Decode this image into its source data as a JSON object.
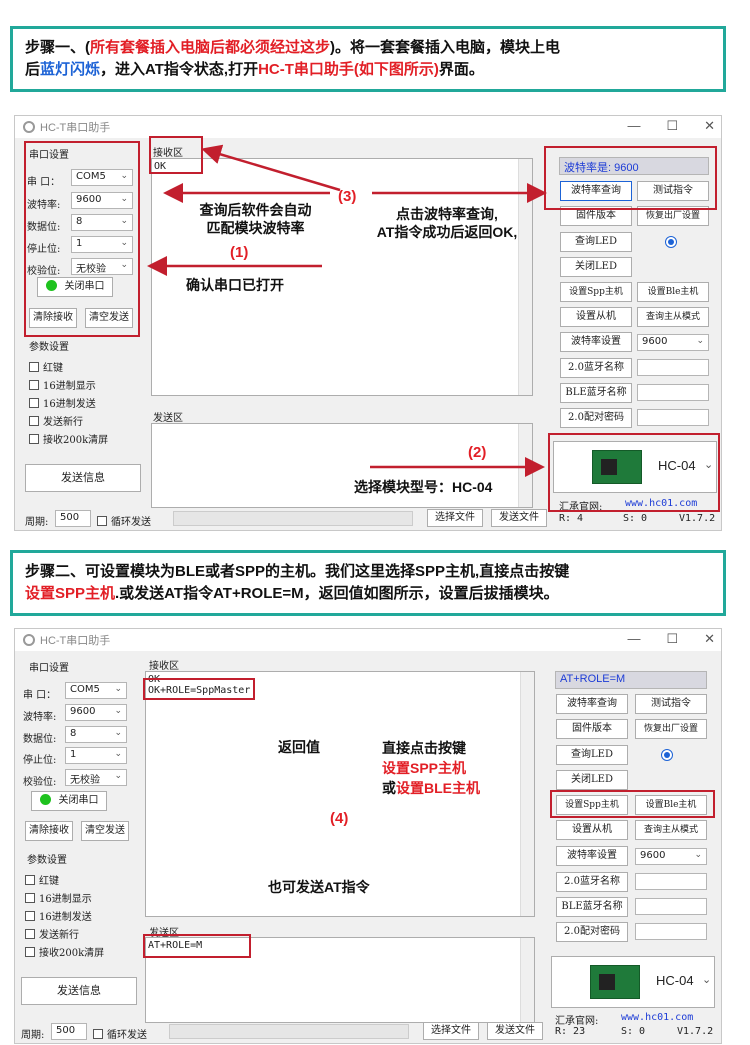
{
  "step1": {
    "p1": "步骤一、(",
    "r1": "所有套餐插入电脑后都必须经过这步",
    "p2": ")。将一套套餐插入电脑，模块上电",
    "p3": "后",
    "b1": "蓝灯闪烁",
    "p4": "，进入AT指令状态,打开",
    "r2": "HC-T串口助手(如下图所示)",
    "p5": "界面。"
  },
  "step2": {
    "p1": "步骤二、可设置模块为BLE或者SPP的主机。我们这里选择SPP主机,直接点击按键",
    "r1": "设置SPP主机",
    "p2": ".或发送AT指令AT+ROLE=M，返回值如图所示，设置后拔插模块。"
  },
  "app": {
    "title": "HC-T串口助手",
    "serial_group": "串口设置",
    "port_label": "串 口：",
    "port_value": "COM5",
    "baud_label": "波特率:",
    "baud_value": "9600",
    "databits_label": "数据位:",
    "databits_value": "8",
    "stopbits_label": "停止位:",
    "stopbits_value": "1",
    "parity_label": "校验位:",
    "parity_value": "无校验",
    "close_port": "关闭串口",
    "clear_recv": "清除接收",
    "clear_send": "清空发送",
    "params_group": "参数设置",
    "opt_hongjian": "红键",
    "opt_hex_show": "16进制显示",
    "opt_hex_send": "16进制发送",
    "opt_newline": "发送新行",
    "opt_clear200k": "接收200k清屏",
    "send_info": "发送信息",
    "recv_label": "接收区",
    "send_label": "发送区",
    "btn_baud_query": "波特率查询",
    "btn_test": "测试指令",
    "btn_firmware": "固件版本",
    "btn_factory": "恢复出厂设置",
    "btn_query_led": "查询LED",
    "btn_close_led": "关闭LED",
    "btn_spp_master": "设置Spp主机",
    "btn_ble_master": "设置Ble主机",
    "btn_slave": "设置从机",
    "btn_query_ms": "查询主从模式",
    "btn_baud_set": "波特率设置",
    "baud_set_value": "9600",
    "btn_name20": "2.0蓝牙名称",
    "btn_ble_name": "BLE蓝牙名称",
    "btn_pin20": "2.0配对密码",
    "module_name": "HC-04",
    "site_label": "汇承官网:",
    "site_url": "www.hc01.com",
    "period_label": "周期:",
    "period_value": "500",
    "loop_send": "循环发送",
    "select_file": "选择文件",
    "send_file": "发送文件",
    "version": "V1.7.2"
  },
  "win1": {
    "status_text": "波特率是: 9600",
    "recv_line1": "OK",
    "send_text": "",
    "rcount": "R: 4",
    "scount": "S: 0"
  },
  "win2": {
    "status_text": "AT+ROLE=M",
    "recv_line1": "OK",
    "recv_line2": "OK+ROLE=SppMaster",
    "send_text": "AT+ROLE=M",
    "rcount": "R: 23",
    "scount": "S: 0"
  },
  "ann1": {
    "n3": "(3)",
    "q1": "查询后软件会自动",
    "q2": "匹配模块波特率",
    "c1": "点击波特率查询,",
    "c2": "AT指令成功后返回OK,",
    "n1": "(1)",
    "confirm": "确认串口已打开",
    "n2": "(2)",
    "select": "选择模块型号：HC-04"
  },
  "ann2": {
    "ret": "返回值",
    "d1": "直接点击按键",
    "d2": "设置SPP主机",
    "d3": "或",
    "d4": "设置BLE主机",
    "n4": "(4)",
    "also": "也可发送AT指令"
  }
}
